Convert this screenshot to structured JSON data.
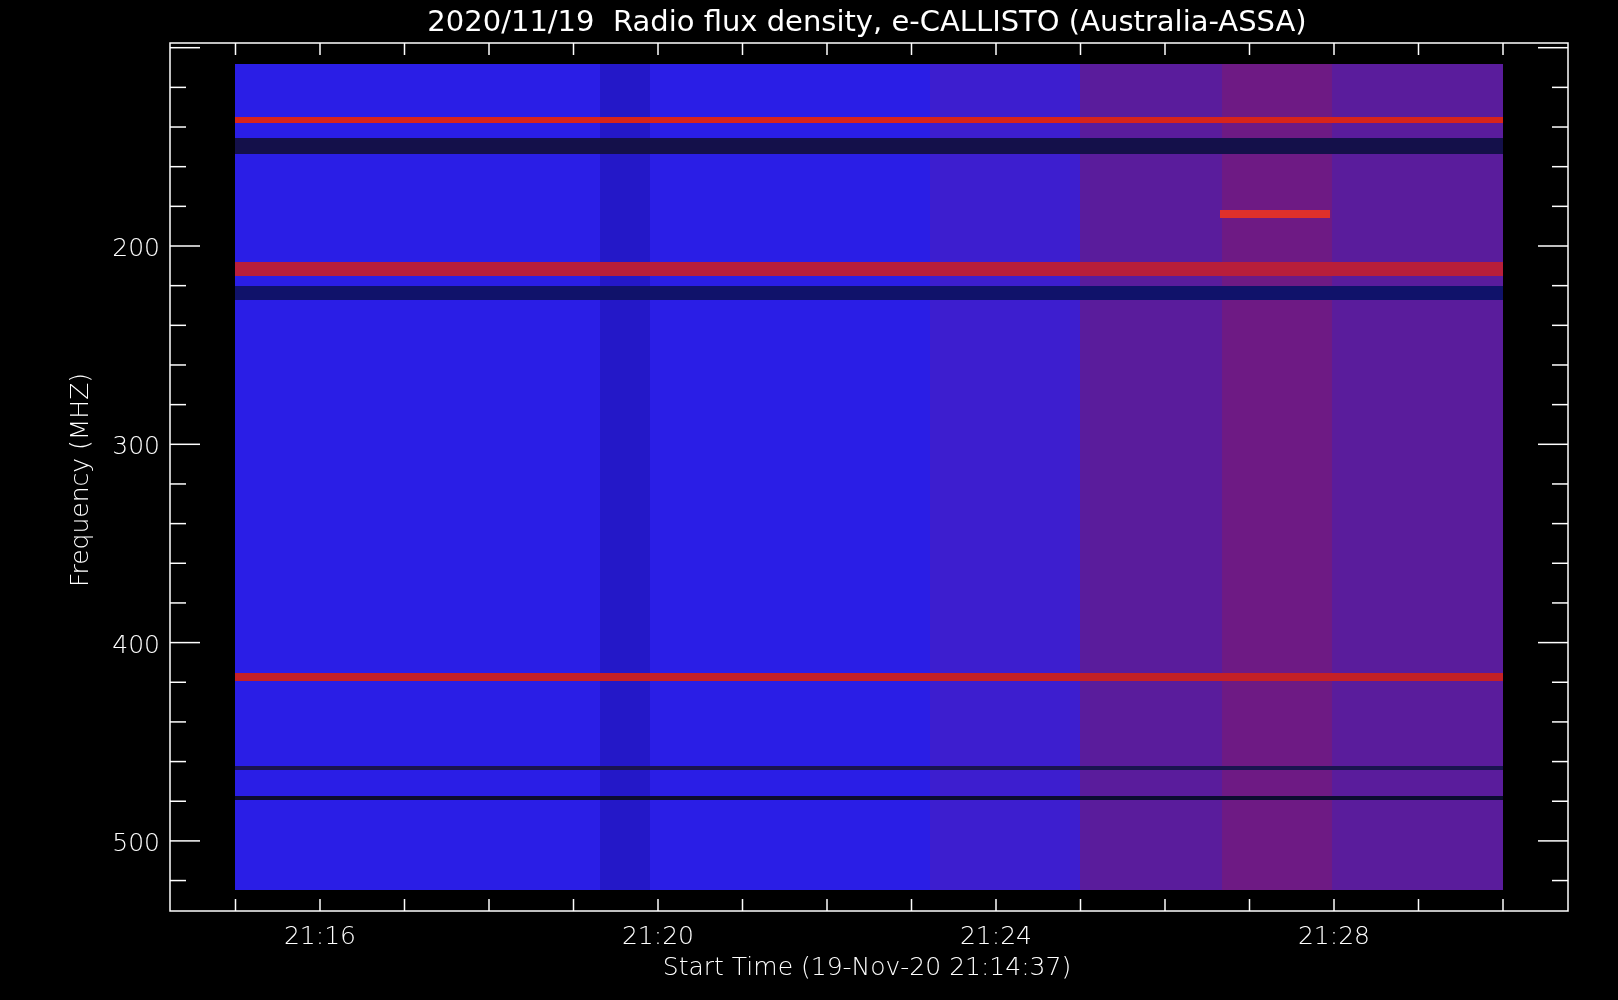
{
  "title": "2020/11/19  Radio flux density, e-CALLISTO (Australia-ASSA)",
  "ylabel": "Frequency (MHZ)",
  "xlabel": "Start Time (19-Nov-20 21:14:37)",
  "yticks": [
    "200",
    "300",
    "400",
    "500"
  ],
  "xticks": [
    "21:16",
    "21:20",
    "21:24",
    "21:28"
  ]
}
